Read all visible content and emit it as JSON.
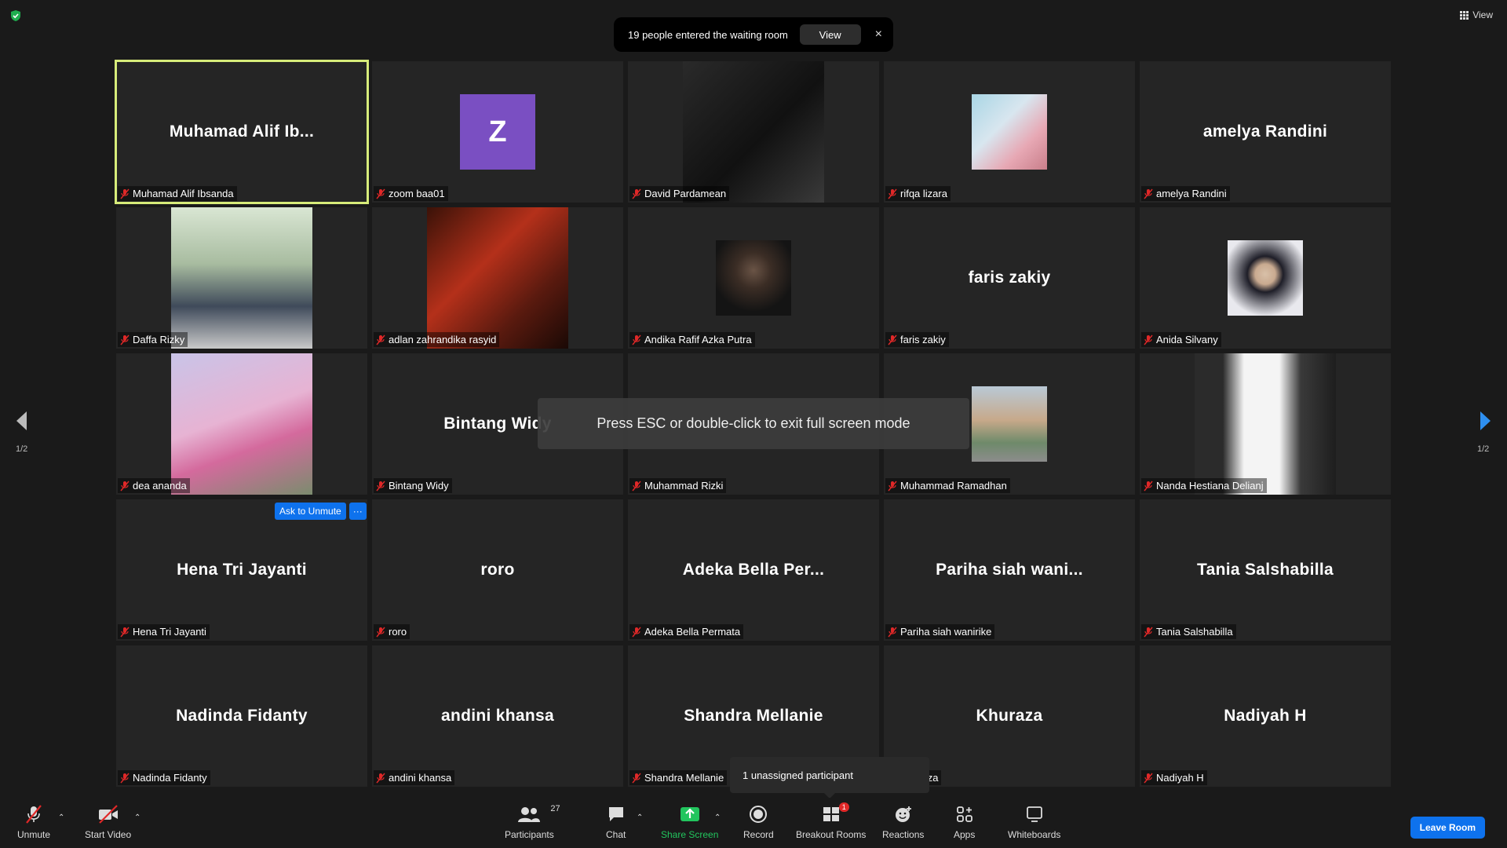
{
  "top": {
    "view_label": "View"
  },
  "notification": {
    "text": "19 people entered the waiting room",
    "button": "View",
    "close": "×"
  },
  "tiles": [
    {
      "big_name": "Muhamad Alif Ib...",
      "label": "Muhamad Alif Ibsanda",
      "kind": "name",
      "active": true
    },
    {
      "big_name": "",
      "label": "zoom baa01",
      "kind": "letter",
      "letter": "Z"
    },
    {
      "big_name": "",
      "label": "David Pardamean",
      "kind": "photo",
      "photo": "dark-portrait"
    },
    {
      "big_name": "",
      "label": "rifqa lizara",
      "kind": "photo",
      "photo": "balloons"
    },
    {
      "big_name": "amelya Randini",
      "label": "amelya Randini",
      "kind": "name"
    },
    {
      "big_name": "",
      "label": "Daffa Rizky",
      "kind": "photo",
      "photo": "two-men"
    },
    {
      "big_name": "",
      "label": "adlan zahrandika rasyid",
      "kind": "photo",
      "photo": "guitar-red"
    },
    {
      "big_name": "",
      "label": "Andika Rafif Azka Putra",
      "kind": "photo",
      "photo": "selfie"
    },
    {
      "big_name": "faris zakiy",
      "label": "faris zakiy",
      "kind": "name"
    },
    {
      "big_name": "",
      "label": "Anida Silvany",
      "kind": "photo",
      "photo": "hijab"
    },
    {
      "big_name": "",
      "label": "dea ananda",
      "kind": "photo",
      "photo": "flowers"
    },
    {
      "big_name": "Bintang Widy",
      "label": "Bintang Widy",
      "kind": "name"
    },
    {
      "big_name": "",
      "label": "Muhammad Rizki",
      "kind": "name"
    },
    {
      "big_name": "",
      "label": "Muhammad Ramadhan",
      "kind": "photo",
      "photo": "building"
    },
    {
      "big_name": "",
      "label": "Nanda Hestiana Delianj",
      "kind": "photo",
      "photo": "window"
    },
    {
      "big_name": "Hena Tri Jayanti",
      "label": "Hena Tri Jayanti",
      "kind": "name",
      "ask_unmute": true
    },
    {
      "big_name": "roro",
      "label": "roro",
      "kind": "name"
    },
    {
      "big_name": "Adeka Bella Per...",
      "label": "Adeka Bella Permata",
      "kind": "name"
    },
    {
      "big_name": "Pariha siah wani...",
      "label": "Pariha siah wanirike",
      "kind": "name"
    },
    {
      "big_name": "Tania Salshabilla",
      "label": "Tania Salshabilla",
      "kind": "name"
    },
    {
      "big_name": "Nadinda Fidanty",
      "label": "Nadinda Fidanty",
      "kind": "name"
    },
    {
      "big_name": "andini khansa",
      "label": "andini khansa",
      "kind": "name"
    },
    {
      "big_name": "Shandra Mellanie",
      "label": "Shandra Mellanie",
      "kind": "name"
    },
    {
      "big_name": "Khuraza",
      "label": "Khuraza",
      "kind": "name"
    },
    {
      "big_name": "Nadiyah H",
      "label": "Nadiyah H",
      "kind": "name"
    }
  ],
  "ask_unmute": {
    "button": "Ask to Unmute",
    "more": "···"
  },
  "esc_toast": "Press ESC or double-click to exit full screen mode",
  "pagination": {
    "left": "1/2",
    "right": "1/2"
  },
  "unassigned_popup": "1 unassigned participant",
  "toolbar": {
    "unmute": "Unmute",
    "start_video": "Start Video",
    "participants": "Participants",
    "participants_count": "27",
    "chat": "Chat",
    "share_screen": "Share Screen",
    "record": "Record",
    "breakout_rooms": "Breakout Rooms",
    "breakout_badge": "1",
    "reactions": "Reactions",
    "apps": "Apps",
    "whiteboards": "Whiteboards",
    "leave_room": "Leave Room"
  },
  "colors": {
    "active_border": "#d7ec7a",
    "accent_blue": "#0e72ed",
    "share_green": "#22c55e",
    "mic_red": "#e02828"
  }
}
